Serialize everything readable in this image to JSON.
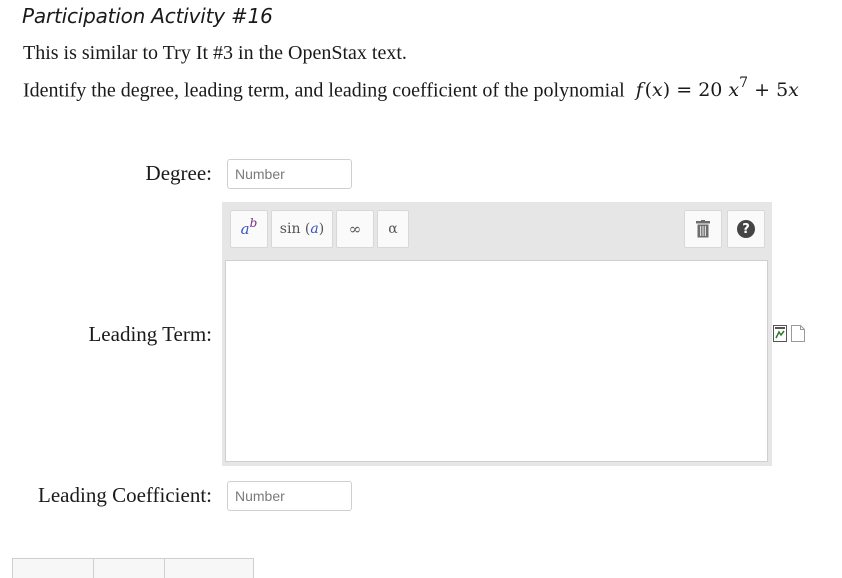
{
  "activity": {
    "title": "Participation Activity #16",
    "intro": "This is similar to Try It #3 in the OpenStax text.",
    "prompt_text": "Identify the degree, leading term, and leading coefficient of the polynomial",
    "polynomial": {
      "lhs": "f",
      "var": "x",
      "coef1": "20",
      "exp1": "7",
      "plus": "+",
      "term2_coef": "5"
    }
  },
  "fields": {
    "degree": {
      "label": "Degree:",
      "placeholder": "Number",
      "value": ""
    },
    "leading_term": {
      "label": "Leading Term:"
    },
    "leading_coefficient": {
      "label": "Leading Coefficient:",
      "placeholder": "Number",
      "value": ""
    }
  },
  "toolbar": {
    "power_base": "a",
    "power_exp": "b",
    "sin_fn": "sin",
    "sin_arg": "a",
    "infinity": "∞",
    "alpha": "α",
    "help": "?"
  },
  "icons": [
    "trash-icon",
    "help-icon",
    "preview-icon",
    "blank-page-icon"
  ]
}
